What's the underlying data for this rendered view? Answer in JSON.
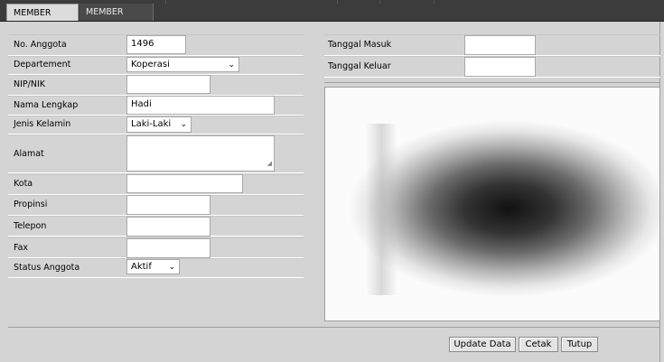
{
  "tabs": [
    {
      "label": "MEMBER DATA",
      "active": true
    },
    {
      "label": "MEMBER TRANS",
      "active": false
    }
  ],
  "form": {
    "no_anggota": {
      "label": "No. Anggota",
      "value": "1496"
    },
    "departement": {
      "label": "Departement",
      "value": "Koperasi"
    },
    "nip_nik": {
      "label": "NIP/NIK",
      "value": ""
    },
    "nama_lengkap": {
      "label": "Nama Lengkap",
      "value": "Hadi"
    },
    "jenis_kelamin": {
      "label": "Jenis Kelamin",
      "value": "Laki-Laki"
    },
    "alamat": {
      "label": "Alamat",
      "value": ""
    },
    "kota": {
      "label": "Kota",
      "value": ""
    },
    "propinsi": {
      "label": "Propinsi",
      "value": ""
    },
    "telepon": {
      "label": "Telepon",
      "value": ""
    },
    "fax": {
      "label": "Fax",
      "value": ""
    },
    "status_anggota": {
      "label": "Status Anggota",
      "value": "Aktif"
    },
    "tanggal_masuk": {
      "label": "Tanggal Masuk",
      "value": ""
    },
    "tanggal_keluar": {
      "label": "Tanggal Keluar",
      "value": ""
    }
  },
  "buttons": {
    "update": "Update Data",
    "print": "Cetak",
    "close": "Tutup"
  },
  "icons": {
    "dropdown": "chevron-down-icon",
    "resize": "resize-grip-icon"
  }
}
